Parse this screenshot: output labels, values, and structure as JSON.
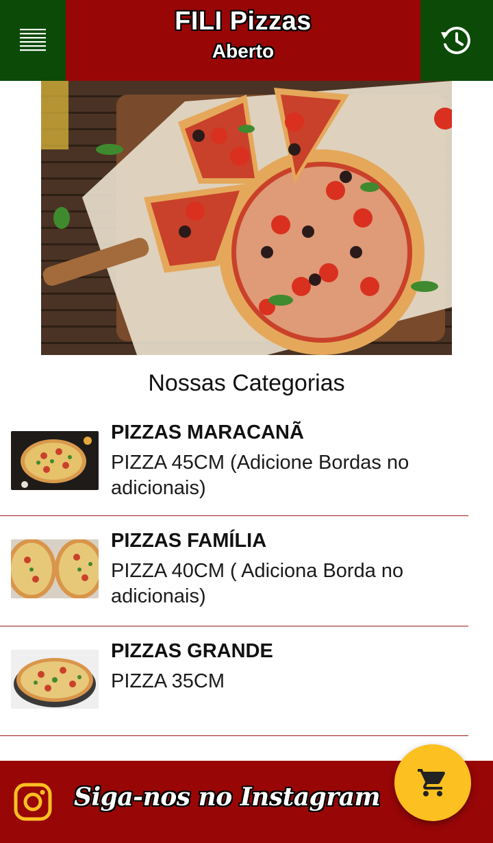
{
  "header": {
    "shop_name": "FILI Pizzas",
    "status": "Aberto",
    "menu_icon": "menu-icon",
    "history_icon": "history-icon",
    "colors": {
      "side_green": "#0b4a07",
      "center_red": "#980606"
    }
  },
  "hero": {
    "image": "pizza-photo"
  },
  "categories": {
    "title": "Nossas Categorias",
    "items": [
      {
        "name": "PIZZAS MARACANÃ",
        "description": "PIZZA 45CM (Adicione Bordas no adicionais)",
        "thumbnail": "pizza-thumb-1"
      },
      {
        "name": "PIZZAS FAMÍLIA",
        "description": "PIZZA 40CM ( Adiciona Borda no adicionais)",
        "thumbnail": "pizza-thumb-2"
      },
      {
        "name": "PIZZAS GRANDE",
        "description": "PIZZA 35CM",
        "thumbnail": "pizza-thumb-3"
      }
    ]
  },
  "footer": {
    "instagram_label": "Siga-nos no Instagram",
    "instagram_icon": "instagram-icon",
    "color": "#980606"
  },
  "cart": {
    "icon": "cart-icon",
    "color": "#fcc021"
  }
}
